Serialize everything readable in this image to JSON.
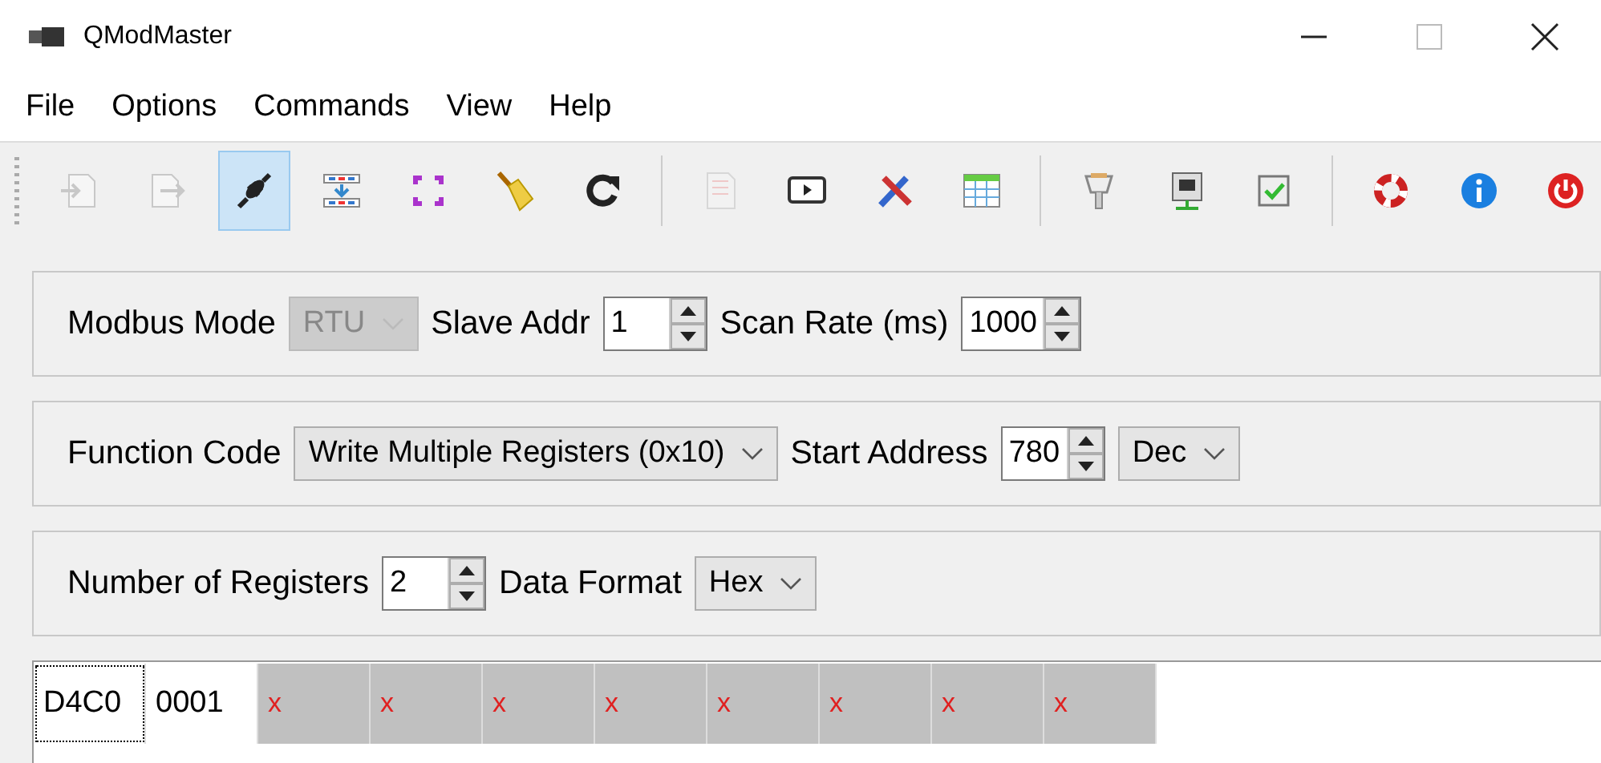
{
  "window": {
    "title": "QModMaster"
  },
  "menu": [
    "File",
    "Options",
    "Commands",
    "View",
    "Help"
  ],
  "toolbar": {
    "groups": [
      [
        {
          "disabled": true,
          "selected": false
        },
        {
          "disabled": true,
          "selected": false
        },
        {
          "disabled": false,
          "selected": true
        },
        {
          "disabled": false,
          "selected": false
        },
        {
          "disabled": false,
          "selected": false
        },
        {
          "disabled": false,
          "selected": false
        },
        {
          "disabled": false,
          "selected": false
        }
      ],
      [
        {
          "disabled": true,
          "selected": false
        },
        {
          "disabled": false,
          "selected": false
        },
        {
          "disabled": false,
          "selected": false
        },
        {
          "disabled": false,
          "selected": false
        }
      ],
      [
        {
          "disabled": false,
          "selected": false
        },
        {
          "disabled": false,
          "selected": false
        },
        {
          "disabled": false,
          "selected": false
        }
      ],
      [
        {
          "disabled": false,
          "selected": false
        },
        {
          "disabled": false,
          "selected": false
        },
        {
          "disabled": false,
          "selected": false
        }
      ]
    ]
  },
  "panels": [
    {
      "fields": [
        {
          "kind": "combo",
          "label": "Modbus Mode",
          "value": "RTU",
          "disabled": true
        },
        {
          "kind": "spin",
          "label": "Slave Addr",
          "value": "1"
        },
        {
          "kind": "spin",
          "label": "Scan Rate (ms)",
          "value": "1000"
        }
      ]
    },
    {
      "fields": [
        {
          "kind": "combo",
          "label": "Function Code",
          "value": "Write Multiple Registers (0x10)",
          "disabled": false
        },
        {
          "kind": "spin",
          "label": "Start Address",
          "value": "780"
        },
        {
          "kind": "combo",
          "value": "Dec",
          "disabled": false
        }
      ]
    },
    {
      "fields": [
        {
          "kind": "spin",
          "label": "Number of Registers",
          "value": "2"
        },
        {
          "kind": "combo",
          "label": "Data Format",
          "value": "Hex",
          "disabled": false
        }
      ]
    }
  ],
  "registers": [
    {
      "text": "D4C0",
      "kind": "value",
      "focused": true
    },
    {
      "text": "0001",
      "kind": "value",
      "focused": false
    },
    {
      "text": "x",
      "kind": "unused",
      "focused": false
    },
    {
      "text": "x",
      "kind": "unused",
      "focused": false
    },
    {
      "text": "x",
      "kind": "unused",
      "focused": false
    },
    {
      "text": "x",
      "kind": "unused",
      "focused": false
    },
    {
      "text": "x",
      "kind": "unused",
      "focused": false
    },
    {
      "text": "x",
      "kind": "unused",
      "focused": false
    },
    {
      "text": "x",
      "kind": "unused",
      "focused": false
    },
    {
      "text": "x",
      "kind": "unused",
      "focused": false
    }
  ]
}
